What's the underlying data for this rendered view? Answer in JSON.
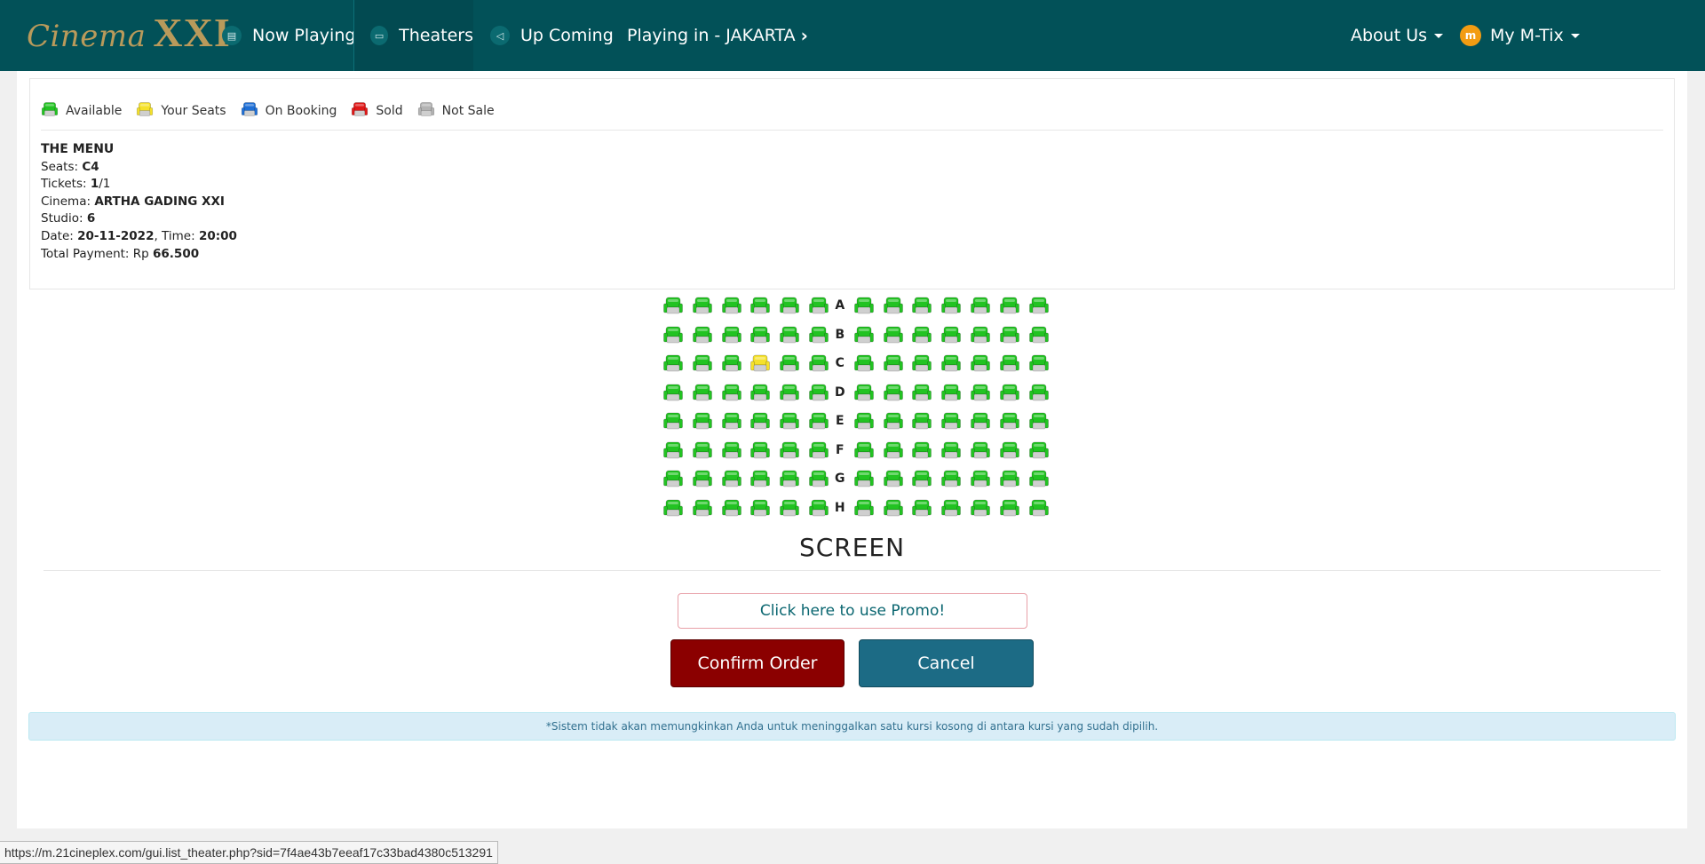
{
  "brand": {
    "script": "Cinema",
    "xxi": "XXI"
  },
  "nav": {
    "now_playing": "Now Playing",
    "theaters": "Theaters",
    "up_coming": "Up Coming",
    "playing_in": "Playing in - JAKARTA",
    "about_us": "About Us",
    "my_mtix": "My M-Tix",
    "avatar_letter": "m"
  },
  "legend": [
    {
      "label": "Available",
      "color": "#22c322"
    },
    {
      "label": "Your Seats",
      "color": "#f5e12a"
    },
    {
      "label": "On Booking",
      "color": "#1e6fd6"
    },
    {
      "label": "Sold",
      "color": "#e01818"
    },
    {
      "label": "Not Sale",
      "color": "#b3b3b3"
    }
  ],
  "order": {
    "title": "THE MENU",
    "seats_label": "Seats: ",
    "seats_value": "C4",
    "tickets_label": "Tickets: ",
    "tickets_value": "1",
    "tickets_total": "/1",
    "cinema_label": "Cinema: ",
    "cinema_value": "ARTHA GADING XXI",
    "studio_label": "Studio: ",
    "studio_value": "6",
    "date_label": "Date: ",
    "date_value": "20-11-2022",
    "time_label": ", Time: ",
    "time_value": "20:00",
    "total_label": "Total Payment: Rp ",
    "total_value": "66.500"
  },
  "seatmap": {
    "rows": [
      "A",
      "B",
      "C",
      "D",
      "E",
      "F",
      "G",
      "H"
    ],
    "left_count": 6,
    "right_count": 7,
    "selected": {
      "row": "C",
      "index": 3
    },
    "colors": {
      "available": "#22c322",
      "yours": "#f5e12a"
    }
  },
  "screen_label": "SCREEN",
  "promo_button": "Click here to use Promo!",
  "confirm_button": "Confirm Order",
  "cancel_button": "Cancel",
  "alert_text": "*Sistem tidak akan memungkinkan Anda untuk meninggalkan satu kursi kosong di antara kursi yang sudah dipilih.",
  "status_url": "https://m.21cineplex.com/gui.list_theater.php?sid=7f4ae43b7eeaf17c33bad4380c513291"
}
